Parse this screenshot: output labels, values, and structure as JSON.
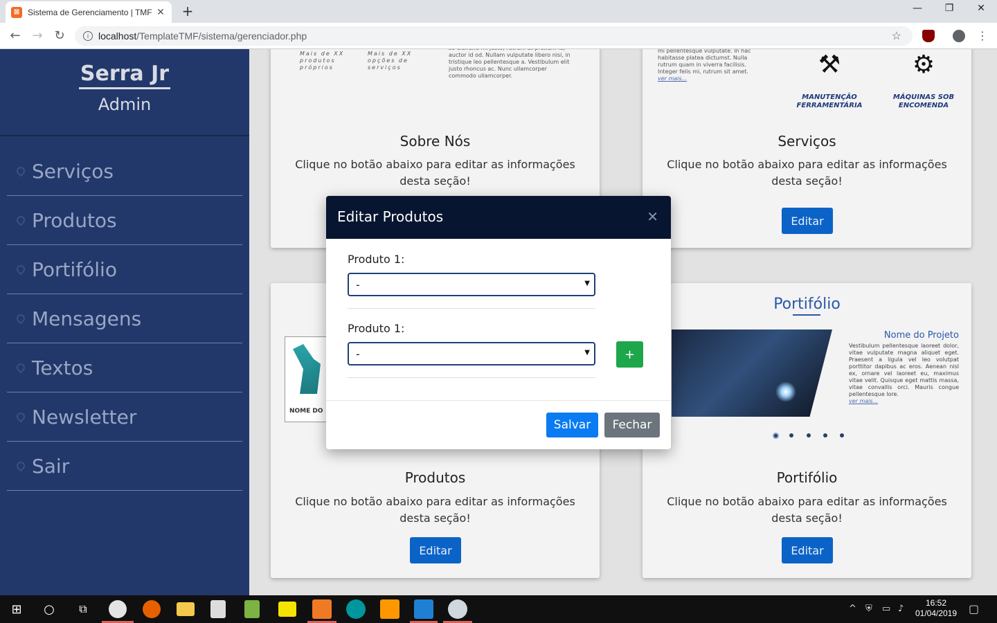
{
  "browser": {
    "tab_title": "Sistema de Gerenciamento | TMF",
    "tab_close": "✕",
    "new_tab": "+",
    "url_host": "localhost",
    "url_path": "/TemplateTMF/sistema/gerenciador.php",
    "back": "←",
    "forward": "→",
    "reload": "↻",
    "star": "☆",
    "menu": "⋮",
    "minimize": "—",
    "maximize": "❐",
    "close": "✕"
  },
  "sidebar": {
    "brand": "Serra Jr",
    "role": "Admin",
    "items": [
      {
        "label": "Serviços"
      },
      {
        "label": "Produtos"
      },
      {
        "label": "Portifólio"
      },
      {
        "label": "Mensagens"
      },
      {
        "label": "Textos"
      },
      {
        "label": "Newsletter"
      },
      {
        "label": "Sair"
      }
    ]
  },
  "cards": {
    "sobre": {
      "title": "Sobre Nós",
      "desc": "Clique no botão abaixo para editar as informações desta seção!",
      "thumb_stat1": "Mais de XX produtos próprios",
      "thumb_stat2": "Mais de XX opções de serviços",
      "thumb_text": "se eleifend mi justo, rutrum at pretium id, auctor id od. Nullam vulputate libero nisi, in tristique leo pellentesque a. Vestibulum elit justo rhoncus ac. Nunc ullamcorper commodo ullamcorper."
    },
    "servicos": {
      "title": "Serviços",
      "desc": "Clique no botão abaixo para editar as informações desta seção!",
      "button": "Editar",
      "thumb_text": "mi pellentesque vulputate. In hac habitasse platea dictumst. Nulla rutrum quam in viverra facilisis. Integer felis mi, rutrum sit amet.",
      "thumb_link": "ver mais...",
      "label1": "MANUTENÇÃO FERRAMENTÁRIA",
      "label2": "MÁQUINAS SOB ENCOMENDA"
    },
    "produtos": {
      "title": "Produtos",
      "desc": "Clique no botão abaixo para editar as informações desta seção!",
      "button": "Editar",
      "thumb_name": "NOME DO"
    },
    "portifolio": {
      "title": "Portifólio",
      "desc": "Clique no botão abaixo para editar as informações desta seção!",
      "button": "Editar",
      "thumb_head": "Portifólio",
      "project_title": "Nome do Projeto",
      "project_text": "Vestibulum pellentesque laoreet dolor, vitae vulputate magna aliquet eget. Praesent a ligula vel leo volutpat porttitor dapibus ac eros. Aenean nisl ex, ornare vel laoreet eu, maximus vitae velit. Quisque eget mattis massa, vitae convallis orci. Mauris congue pellentesque lore.",
      "project_link": "ver mais..."
    }
  },
  "modal": {
    "title": "Editar Produtos",
    "close": "✕",
    "field1_label": "Produto 1:",
    "field1_value": "-",
    "field2_label": "Produto 1:",
    "field2_value": "-",
    "add_button": "+",
    "save_button": "Salvar",
    "close_button": "Fechar"
  },
  "taskbar": {
    "time": "16:52",
    "date": "01/04/2019"
  }
}
